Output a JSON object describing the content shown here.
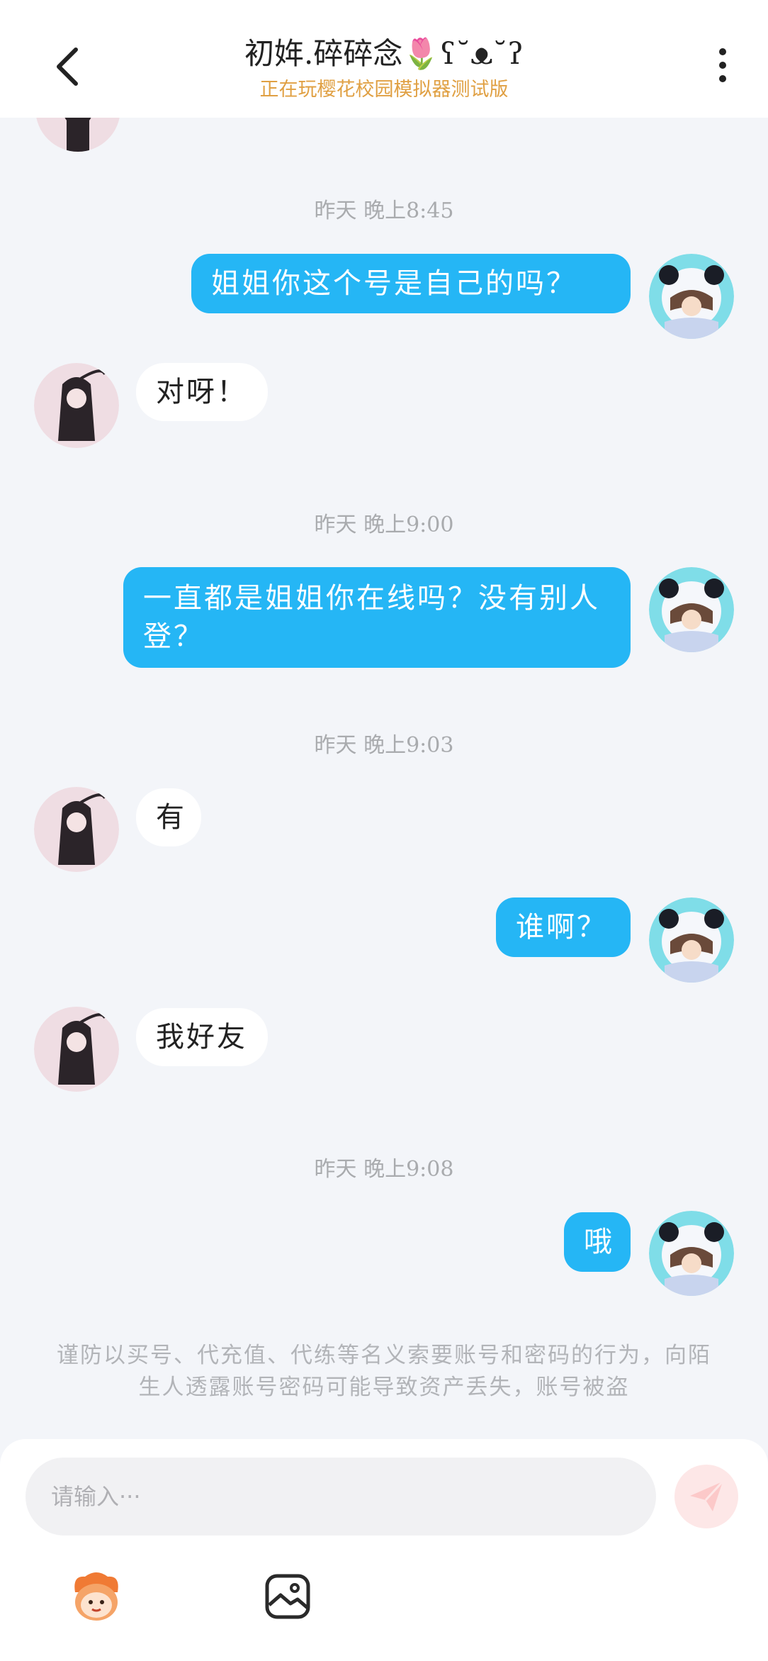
{
  "header": {
    "title": "初姩.碎碎念🌷ʕ˘ᴥ˘ʔ",
    "subtitle": "正在玩樱花校园模拟器测试版"
  },
  "messages": [
    {
      "type": "time",
      "text": "昨天 晚上8:45"
    },
    {
      "type": "me",
      "text": "姐姐你这个号是自己的吗？"
    },
    {
      "type": "other",
      "text": "对呀！"
    },
    {
      "type": "time",
      "text": "昨天 晚上9:00"
    },
    {
      "type": "me",
      "text": "一直都是姐姐你在线吗？没有别人登？"
    },
    {
      "type": "time",
      "text": "昨天 晚上9:03"
    },
    {
      "type": "other",
      "text": "有"
    },
    {
      "type": "me",
      "text": "谁啊？"
    },
    {
      "type": "other",
      "text": "我好友"
    },
    {
      "type": "time",
      "text": "昨天 晚上9:08"
    },
    {
      "type": "me",
      "text": "哦"
    }
  ],
  "notice": "谨防以买号、代充值、代练等名义索要账号和密码的行为，向陌生人透露账号密码可能导致资产丢失，账号被盗",
  "composer": {
    "placeholder": "请输入···"
  },
  "colors": {
    "accent": "#25b6f5",
    "subtitle": "#e0a043",
    "background": "#f3f5f9"
  },
  "icons": [
    "back-arrow-icon",
    "more-vertical-icon",
    "send-icon",
    "emoji-mascot-icon",
    "image-icon"
  ]
}
